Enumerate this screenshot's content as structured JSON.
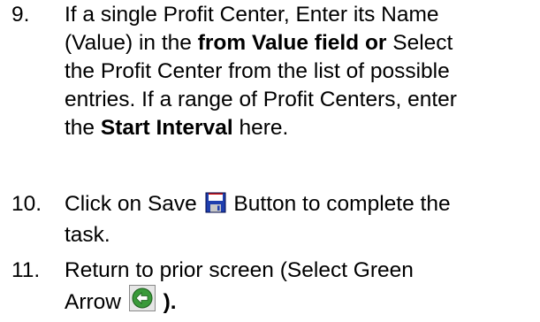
{
  "steps": [
    {
      "number": "9.",
      "lines": [
        [
          "If a single Profit Center, Enter its Name"
        ],
        [
          "(Value) in the ",
          "from Value field or",
          " Select"
        ],
        [
          "the Profit Center from the list of possible"
        ],
        [
          "entries. If a range of Profit Centers, enter"
        ],
        [
          "the ",
          "Start Interval",
          " here."
        ]
      ]
    },
    {
      "number": "10.",
      "text_before_icon": "Click on Save",
      "icon": "save-floppy-icon",
      "text_after_icon": "Button to complete the",
      "line2": "task."
    },
    {
      "number": "11.",
      "line1": "Return to prior screen (Select Green",
      "text_before_icon": "Arrow",
      "icon": "green-back-arrow-icon",
      "text_after_icon": ")."
    }
  ],
  "colors": {
    "save_icon_blue": "#1f3fae",
    "save_icon_red": "#d01818",
    "back_arrow_green": "#3a9a3a"
  }
}
